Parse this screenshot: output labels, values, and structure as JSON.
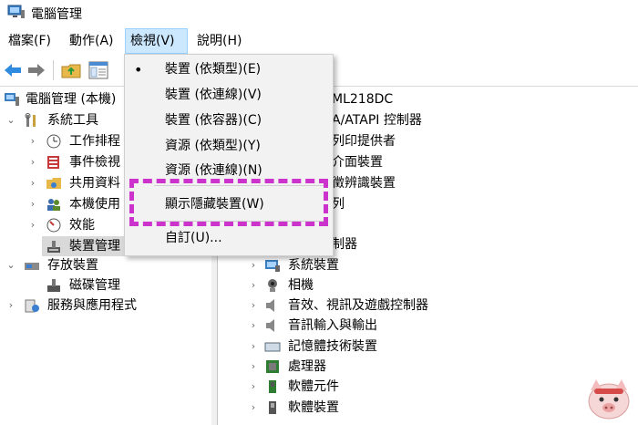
{
  "window": {
    "title": "電腦管理"
  },
  "menubar": {
    "items": [
      "檔案(F)",
      "動作(A)",
      "檢視(V)",
      "說明(H)"
    ]
  },
  "view_menu": {
    "items": [
      {
        "label": "裝置 (依類型)(E)",
        "checked": true
      },
      {
        "label": "裝置 (依連線)(V)",
        "checked": false
      },
      {
        "label": "裝置 (依容器)(C)",
        "checked": false
      },
      {
        "label": "資源 (依類型)(Y)",
        "checked": false
      },
      {
        "label": "資源 (依連線)(N)",
        "checked": false
      },
      {
        "label": "顯示隱藏裝置(W)",
        "checked": false
      },
      {
        "label": "自訂(U)...",
        "checked": false
      }
    ]
  },
  "left_tree": {
    "root": "電腦管理 (本機)",
    "system_tools": "系統工具",
    "task_scheduler": "工作排程",
    "event_viewer": "事件檢視",
    "shared_folders": "共用資料",
    "local_users": "本機使用",
    "performance": "效能",
    "device_manager": "裝置管理",
    "storage": "存放裝置",
    "disk_management": "磁碟管理",
    "services": "服務與應用程式"
  },
  "right_tree": {
    "computer_fragment": "ML218DC",
    "ata_fragment": "A/ATAPI 控制器",
    "print_fragment": "列印提供者",
    "interface_fragment": "介面裝置",
    "biometric_fragment": "徵辨識裝置",
    "queue_fragment": "列",
    "controller_fragment": "制器",
    "items": [
      "系統裝置",
      "相機",
      "音效、視訊及遊戲控制器",
      "音訊輸入與輸出",
      "記憶體技術裝置",
      "處理器",
      "軟體元件",
      "軟體裝置"
    ]
  }
}
